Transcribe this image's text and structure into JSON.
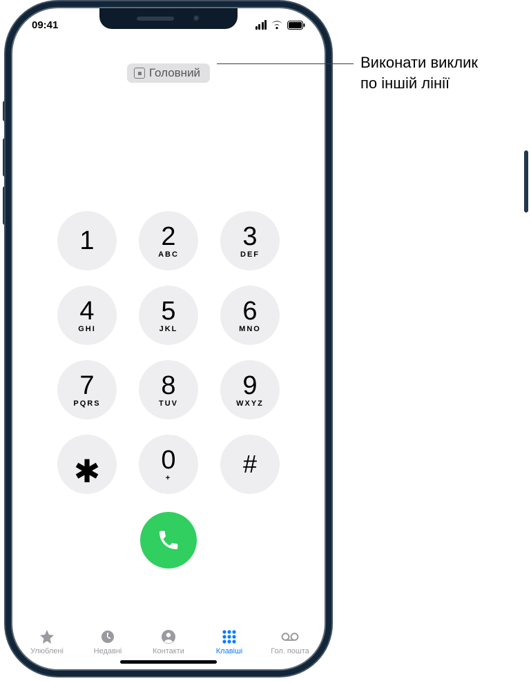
{
  "status": {
    "time": "09:41"
  },
  "sim": {
    "label": "Головний"
  },
  "keypad": [
    {
      "digit": "1",
      "sub": ""
    },
    {
      "digit": "2",
      "sub": "ABC"
    },
    {
      "digit": "3",
      "sub": "DEF"
    },
    {
      "digit": "4",
      "sub": "GHI"
    },
    {
      "digit": "5",
      "sub": "JKL"
    },
    {
      "digit": "6",
      "sub": "MNO"
    },
    {
      "digit": "7",
      "sub": "PQRS"
    },
    {
      "digit": "8",
      "sub": "TUV"
    },
    {
      "digit": "9",
      "sub": "WXYZ"
    },
    {
      "digit": "✱",
      "sub": ""
    },
    {
      "digit": "0",
      "sub": "+"
    },
    {
      "digit": "#",
      "sub": ""
    }
  ],
  "tabs": {
    "favorites": "Улюблені",
    "recents": "Недавні",
    "contacts": "Контакти",
    "keypad": "Клавіші",
    "voicemail": "Гол. пошта"
  },
  "callout": {
    "line1": "Виконати виклик",
    "line2": "по іншій лінії"
  }
}
